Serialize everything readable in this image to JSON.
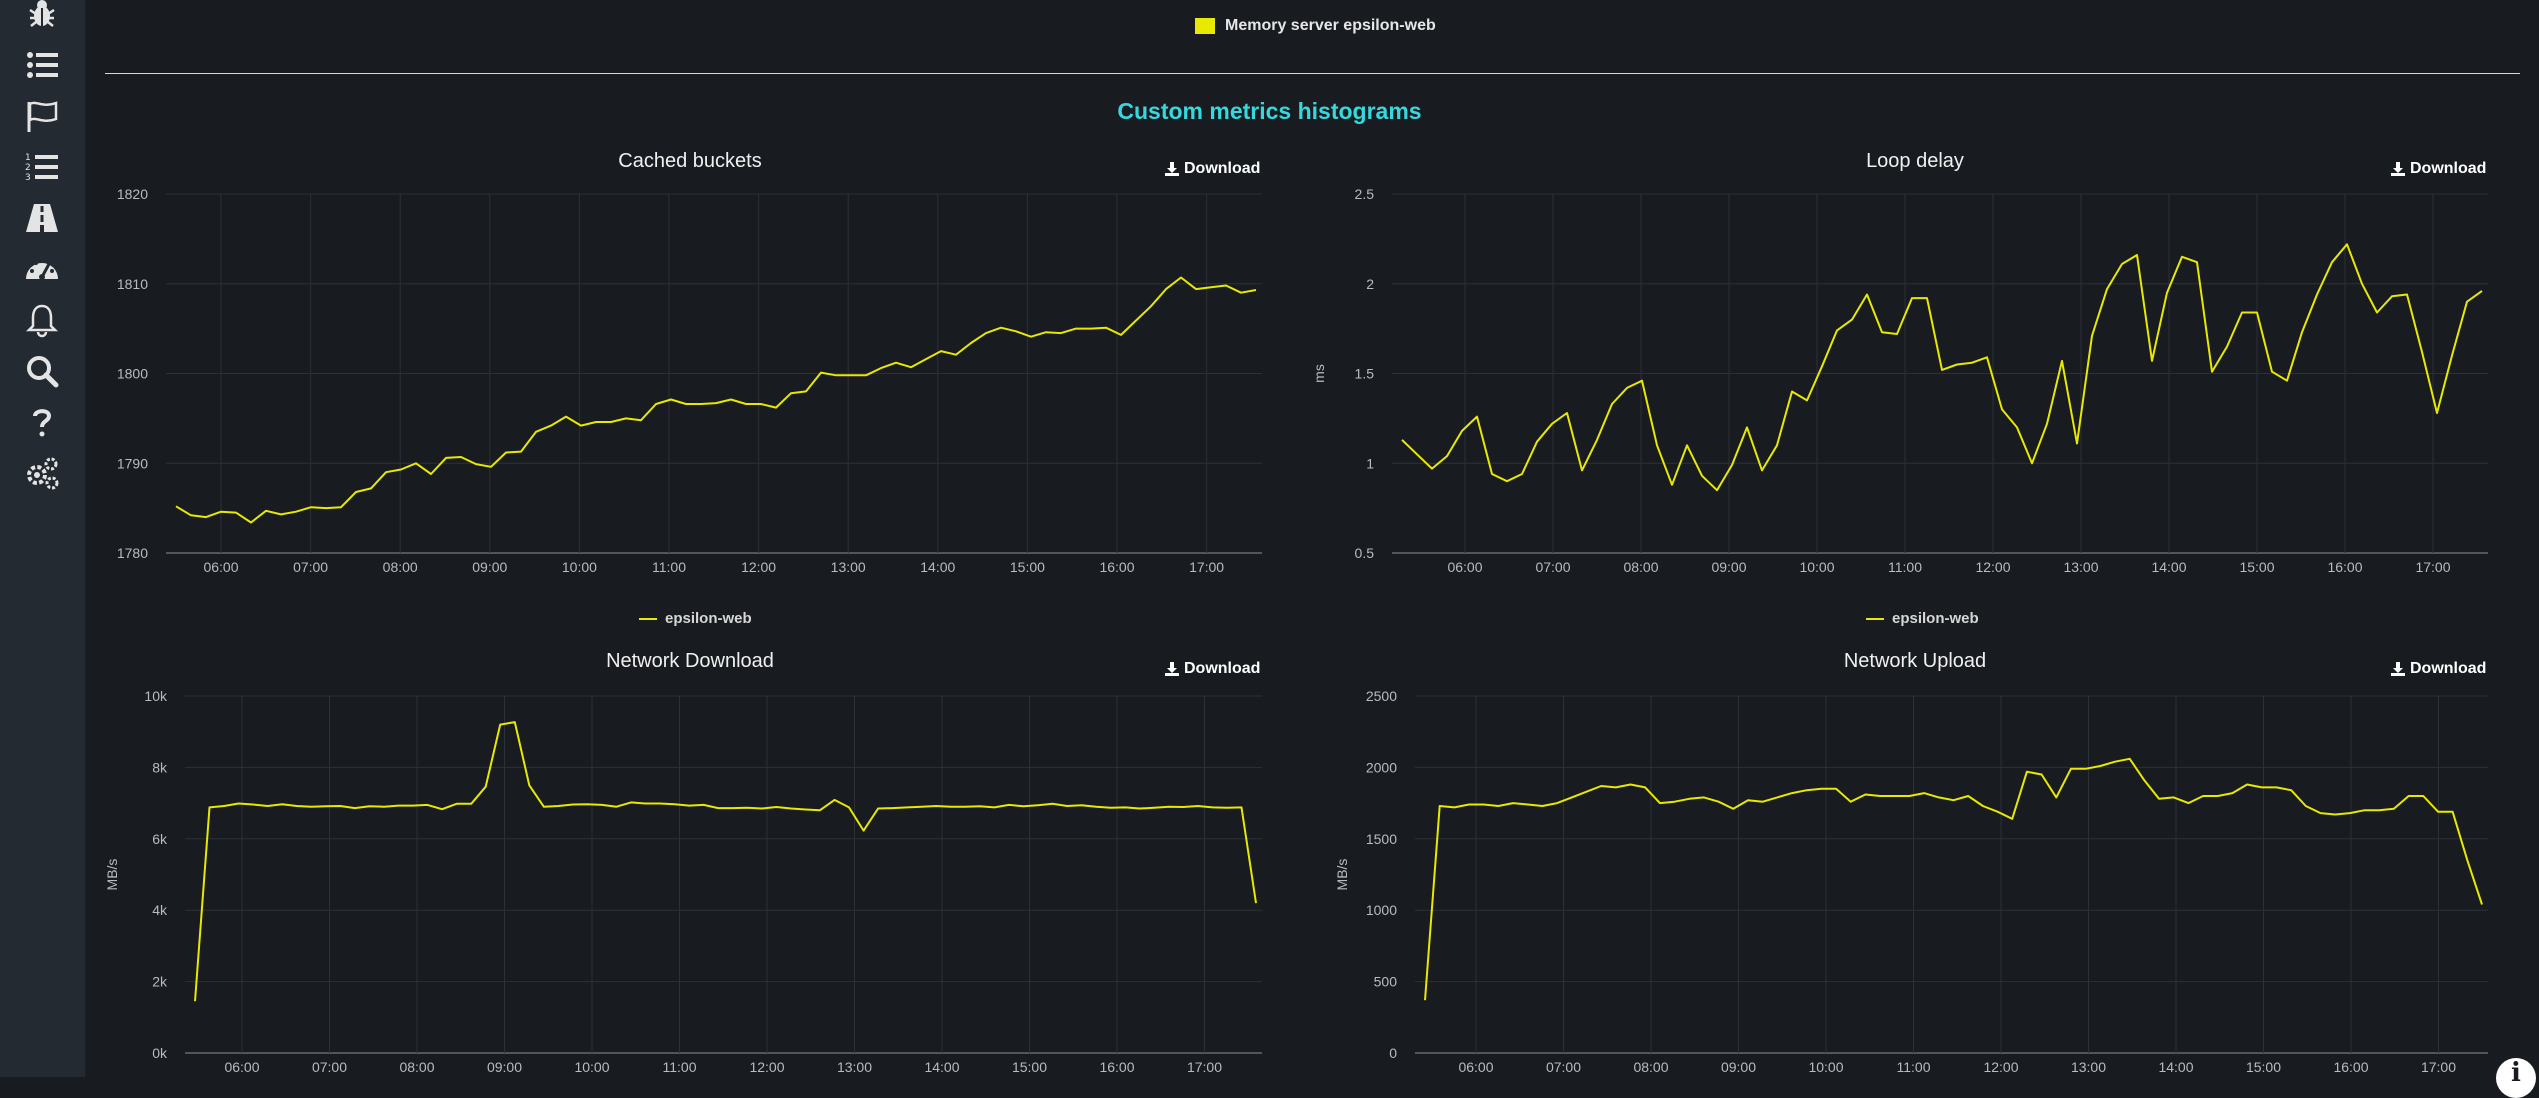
{
  "top_legend": {
    "label": "Memory server epsilon-web",
    "color": "#e8e800"
  },
  "section_title": "Custom metrics histograms",
  "download_label": "Download",
  "sidebar_icons": [
    "bug-icon",
    "list-icon",
    "flag-icon",
    "ordered-list-icon",
    "road-icon",
    "dashboard-icon",
    "bell-icon",
    "search-icon",
    "question-icon",
    "gears-icon"
  ],
  "colors": {
    "background": "#181c21",
    "sidebar": "#242a31",
    "series": "#e8e800",
    "grid": "#2c3137",
    "title_accent": "#36d7de"
  },
  "chart_data": [
    {
      "id": "cached-buckets",
      "type": "line",
      "title": "Cached buckets",
      "xlabel": "",
      "ylabel": "",
      "x_tick_labels": [
        "06:00",
        "07:00",
        "08:00",
        "09:00",
        "10:00",
        "11:00",
        "12:00",
        "13:00",
        "14:00",
        "15:00",
        "16:00",
        "17:00"
      ],
      "y_ticks": [
        "1780",
        "1790",
        "1800",
        "1810",
        "1820"
      ],
      "ylim": [
        1780,
        1820
      ],
      "grid": true,
      "legend": "epsilon-web",
      "series": [
        {
          "name": "epsilon-web",
          "values": [
            1785.2,
            1784.2,
            1784.0,
            1784.6,
            1784.5,
            1783.4,
            1784.7,
            1784.3,
            1784.6,
            1785.1,
            1785.0,
            1785.1,
            1786.8,
            1787.2,
            1789.0,
            1789.3,
            1790.0,
            1788.8,
            1790.6,
            1790.7,
            1789.9,
            1789.6,
            1791.2,
            1791.3,
            1793.5,
            1794.2,
            1795.2,
            1794.2,
            1794.6,
            1794.6,
            1795.0,
            1794.8,
            1796.6,
            1797.1,
            1796.6,
            1796.6,
            1796.7,
            1797.1,
            1796.6,
            1796.6,
            1796.2,
            1797.8,
            1798.0,
            1800.1,
            1799.8,
            1799.8,
            1799.8,
            1800.6,
            1801.2,
            1800.7,
            1801.6,
            1802.5,
            1802.1,
            1803.4,
            1804.5,
            1805.1,
            1804.7,
            1804.1,
            1804.6,
            1804.5,
            1805.0,
            1805.0,
            1805.1,
            1804.3,
            1805.9,
            1807.5,
            1809.4,
            1810.7,
            1809.4,
            1809.6,
            1809.8,
            1809.0,
            1809.3
          ]
        }
      ]
    },
    {
      "id": "loop-delay",
      "type": "line",
      "title": "Loop delay",
      "xlabel": "",
      "ylabel": "ms",
      "x_tick_labels": [
        "06:00",
        "07:00",
        "08:00",
        "09:00",
        "10:00",
        "11:00",
        "12:00",
        "13:00",
        "14:00",
        "15:00",
        "16:00",
        "17:00"
      ],
      "y_ticks": [
        "0.5",
        "1",
        "1.5",
        "2",
        "2.5"
      ],
      "ylim": [
        0.5,
        2.5
      ],
      "grid": true,
      "legend": "epsilon-web",
      "series": [
        {
          "name": "epsilon-web",
          "values": [
            1.13,
            1.05,
            0.97,
            1.04,
            1.18,
            1.26,
            0.94,
            0.9,
            0.94,
            1.12,
            1.22,
            1.28,
            0.96,
            1.13,
            1.33,
            1.42,
            1.46,
            1.1,
            0.88,
            1.1,
            0.93,
            0.85,
            0.99,
            1.2,
            0.96,
            1.1,
            1.4,
            1.35,
            1.54,
            1.74,
            1.8,
            1.94,
            1.73,
            1.72,
            1.92,
            1.92,
            1.52,
            1.55,
            1.56,
            1.59,
            1.3,
            1.2,
            1.0,
            1.22,
            1.57,
            1.11,
            1.71,
            1.97,
            2.11,
            2.16,
            1.57,
            1.95,
            2.15,
            2.12,
            1.51,
            1.65,
            1.84,
            1.84,
            1.51,
            1.46,
            1.73,
            1.94,
            2.12,
            2.22,
            2.0,
            1.84,
            1.93,
            1.94,
            1.62,
            1.28,
            1.6,
            1.9,
            1.96
          ]
        }
      ]
    },
    {
      "id": "network-download",
      "type": "line",
      "title": "Network Download",
      "xlabel": "",
      "ylabel": "MB/s",
      "x_tick_labels": [
        "06:00",
        "07:00",
        "08:00",
        "09:00",
        "10:00",
        "11:00",
        "12:00",
        "13:00",
        "14:00",
        "15:00",
        "16:00",
        "17:00"
      ],
      "y_ticks": [
        "0k",
        "2k",
        "4k",
        "6k",
        "8k",
        "10k"
      ],
      "ylim": [
        0,
        10000
      ],
      "grid": true,
      "legend": "",
      "series": [
        {
          "name": "",
          "values": [
            1450,
            6880,
            6920,
            6990,
            6960,
            6920,
            6970,
            6920,
            6900,
            6910,
            6920,
            6860,
            6910,
            6900,
            6930,
            6930,
            6950,
            6830,
            6980,
            6980,
            7460,
            9200,
            9270,
            7500,
            6900,
            6920,
            6960,
            6970,
            6950,
            6900,
            7020,
            6990,
            6990,
            6970,
            6930,
            6950,
            6860,
            6860,
            6870,
            6850,
            6890,
            6850,
            6820,
            6800,
            7090,
            6880,
            6230,
            6850,
            6860,
            6880,
            6900,
            6920,
            6900,
            6900,
            6910,
            6880,
            6950,
            6910,
            6940,
            6980,
            6920,
            6940,
            6900,
            6870,
            6880,
            6850,
            6870,
            6900,
            6890,
            6920,
            6880,
            6870,
            6880,
            4200
          ]
        }
      ]
    },
    {
      "id": "network-upload",
      "type": "line",
      "title": "Network Upload",
      "xlabel": "",
      "ylabel": "MB/s",
      "x_tick_labels": [
        "06:00",
        "07:00",
        "08:00",
        "09:00",
        "10:00",
        "11:00",
        "12:00",
        "13:00",
        "14:00",
        "15:00",
        "16:00",
        "17:00"
      ],
      "y_ticks": [
        "0",
        "500",
        "1000",
        "1500",
        "2000",
        "2500"
      ],
      "ylim": [
        0,
        2500
      ],
      "grid": true,
      "legend": "",
      "series": [
        {
          "name": "",
          "values": [
            370,
            1730,
            1720,
            1740,
            1740,
            1730,
            1750,
            1740,
            1730,
            1750,
            1790,
            1830,
            1870,
            1860,
            1880,
            1860,
            1750,
            1760,
            1780,
            1790,
            1760,
            1710,
            1770,
            1760,
            1790,
            1820,
            1840,
            1850,
            1850,
            1760,
            1810,
            1800,
            1800,
            1800,
            1820,
            1790,
            1770,
            1800,
            1730,
            1690,
            1640,
            1970,
            1950,
            1790,
            1990,
            1990,
            2010,
            2040,
            2060,
            1910,
            1780,
            1790,
            1750,
            1800,
            1800,
            1820,
            1880,
            1860,
            1860,
            1840,
            1730,
            1680,
            1670,
            1680,
            1700,
            1700,
            1710,
            1800,
            1800,
            1690,
            1690,
            1350,
            1040
          ]
        }
      ]
    }
  ]
}
